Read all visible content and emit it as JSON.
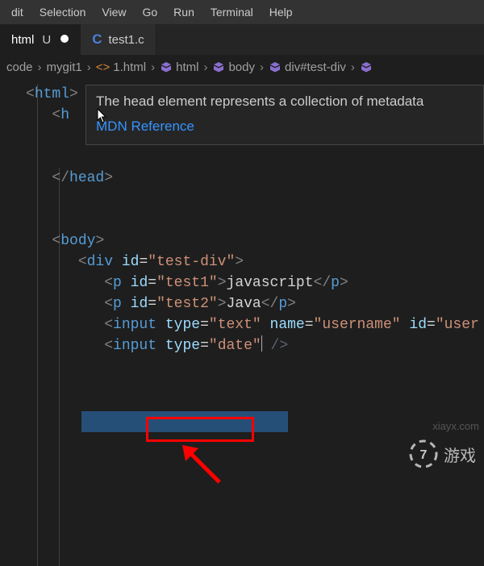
{
  "menubar": [
    "dit",
    "Selection",
    "View",
    "Go",
    "Run",
    "Terminal",
    "Help"
  ],
  "tabs": [
    {
      "label": "html",
      "modifier": "U",
      "dirty": true,
      "active": true
    },
    {
      "label": "test1.c",
      "icon": "C",
      "active": false
    }
  ],
  "breadcrumbs": [
    {
      "label": "code",
      "icon": ""
    },
    {
      "label": "mygit1",
      "icon": ""
    },
    {
      "label": "1.html",
      "icon": "file"
    },
    {
      "label": "html",
      "icon": "cube"
    },
    {
      "label": "body",
      "icon": "cube"
    },
    {
      "label": "div#test-div",
      "icon": "cube"
    }
  ],
  "hover": {
    "text": "The head element represents a collection of metadata",
    "link": "MDN Reference"
  },
  "code": {
    "l1_html": "html",
    "l2_h": "h",
    "l3_head": "head",
    "l4_body": "body",
    "l5_div": "div",
    "l5_id": "id",
    "l5_idval": "\"test-div\"",
    "l6_p": "p",
    "l6_id": "id",
    "l6_idval": "\"test1\"",
    "l6_text": "javascript",
    "l7_p": "p",
    "l7_id": "id",
    "l7_idval": "\"test2\"",
    "l7_text": "Java",
    "l8_input": "input",
    "l8_type": "type",
    "l8_typeval": "\"text\"",
    "l8_name": "name",
    "l8_nameval": "\"username\"",
    "l8_id": "id",
    "l8_idval": "\"user",
    "l9_input": "input",
    "l9_type": "type",
    "l9_typeval": "\"date\""
  },
  "watermarks": {
    "w1": "xiayx.com",
    "w2": "游戏"
  }
}
